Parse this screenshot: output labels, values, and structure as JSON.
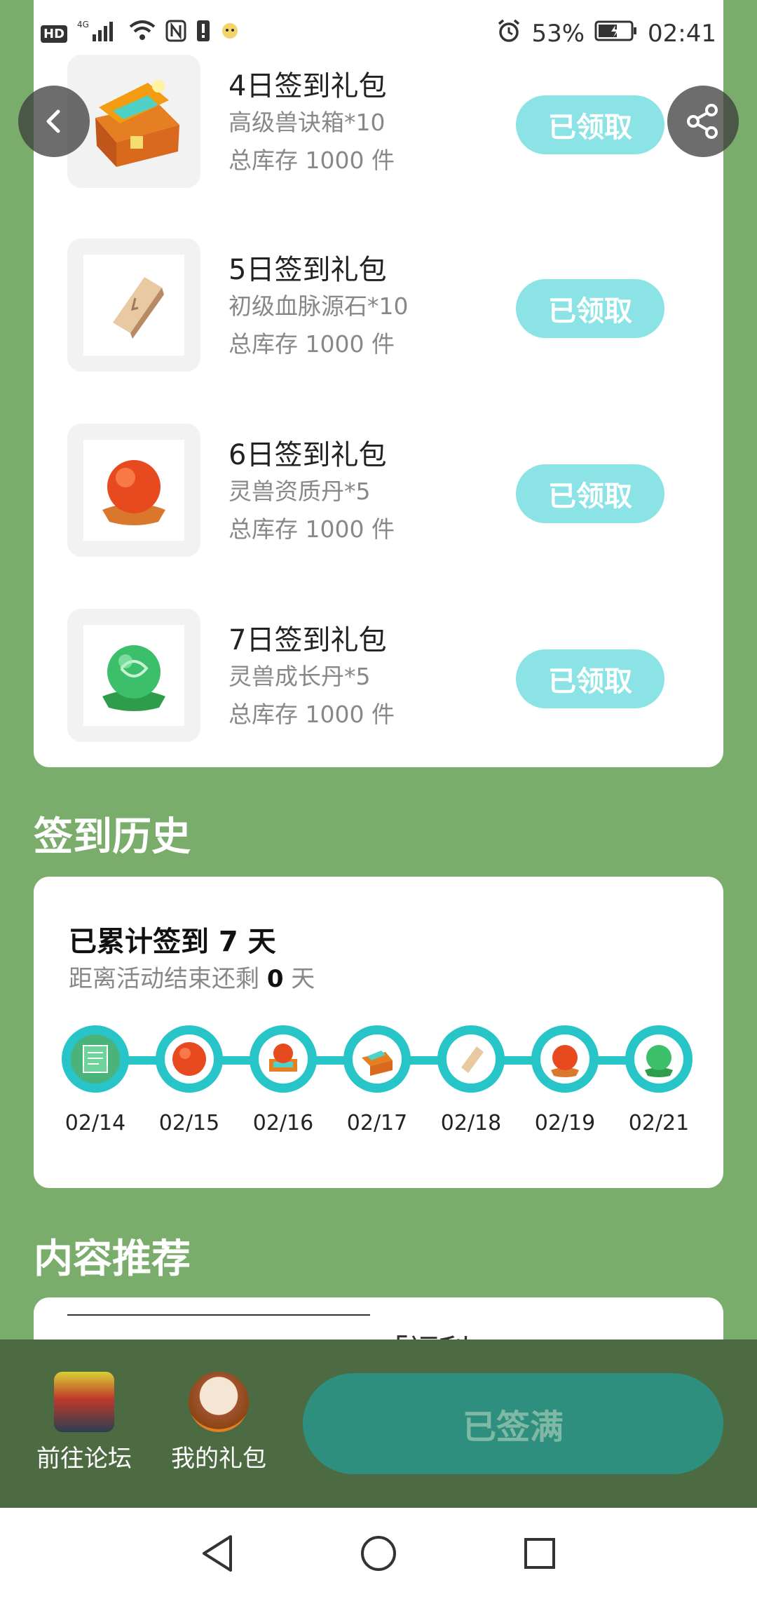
{
  "status_bar": {
    "left_badges": [
      "HD",
      "4G"
    ],
    "battery": "53%",
    "time": "02:41"
  },
  "gifts": [
    {
      "title": "4日签到礼包",
      "item": "高级兽诀箱*10",
      "stock": "总库存 1000 件",
      "button": "已领取",
      "icon": "treasure-chest-icon"
    },
    {
      "title": "5日签到礼包",
      "item": "初级血脉源石*10",
      "stock": "总库存 1000 件",
      "button": "已领取",
      "icon": "stone-tile-icon"
    },
    {
      "title": "6日签到礼包",
      "item": "灵兽资质丹*5",
      "stock": "总库存 1000 件",
      "button": "已领取",
      "icon": "red-orb-icon"
    },
    {
      "title": "7日签到礼包",
      "item": "灵兽成长丹*5",
      "stock": "总库存 1000 件",
      "button": "已领取",
      "icon": "green-orb-icon"
    }
  ],
  "history": {
    "section_title": "签到历史",
    "title": "已累计签到 7 天",
    "sub_prefix": "距离活动结束还剩 ",
    "sub_days": "0",
    "sub_suffix": " 天",
    "dates": [
      "02/14",
      "02/15",
      "02/16",
      "02/17",
      "02/18",
      "02/19",
      "02/21"
    ]
  },
  "recommend": {
    "section_title": "内容推荐",
    "partial_title": "「福利」"
  },
  "bottom_bar": {
    "forum_label": "前往论坛",
    "gifts_label": "我的礼包",
    "full_button": "已签满"
  },
  "colors": {
    "background": "#7aad6c",
    "claim_button": "#8be3e6",
    "timeline": "#27c4c8",
    "bottom_bar": "#4d6b42",
    "full_button": "#2e8f7f"
  }
}
